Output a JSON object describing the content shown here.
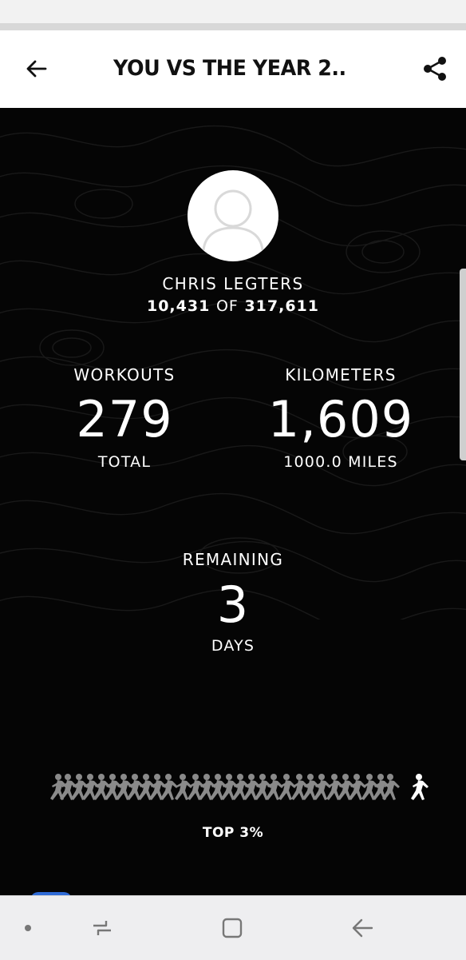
{
  "header": {
    "title": "YOU VS THE YEAR 2.."
  },
  "profile": {
    "name": "CHRIS LEGTERS",
    "rank": "10,431",
    "rank_of": "OF",
    "total_participants": "317,611"
  },
  "stats": {
    "workouts": {
      "label": "WORKOUTS",
      "value": "279",
      "sub": "TOTAL"
    },
    "kilometers": {
      "label": "KILOMETERS",
      "value": "1,609",
      "sub": "1000.0 MILES"
    }
  },
  "remaining": {
    "label": "REMAINING",
    "value": "3",
    "unit": "DAYS"
  },
  "ranking": {
    "percentile_label": "TOP 3%"
  },
  "icons": {
    "back": "back-arrow-icon",
    "share": "share-icon",
    "avatar": "default-avatar-icon",
    "runners": "runner-crowd-icon",
    "user_runner": "runner-icon",
    "nav_recent": "recent-apps-icon",
    "nav_home": "home-icon",
    "nav_back": "nav-back-icon"
  },
  "colors": {
    "background": "#050505",
    "runner_crowd": "#8a8a8a",
    "runner_user": "#ffffff"
  }
}
